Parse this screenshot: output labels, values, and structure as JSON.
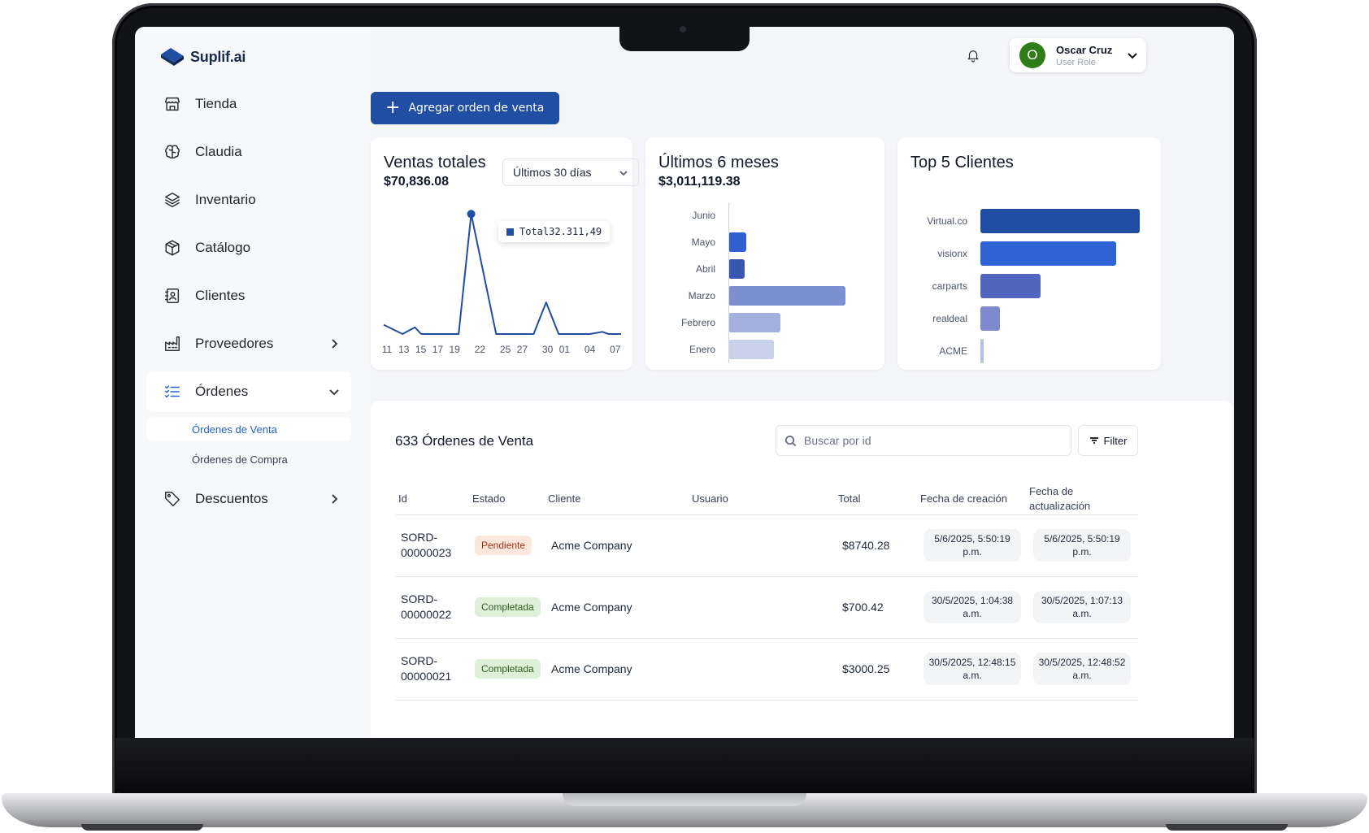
{
  "brand": {
    "name": "Suplif.ai"
  },
  "sidebar": {
    "items": [
      {
        "label": "Tienda",
        "icon": "store-icon"
      },
      {
        "label": "Claudia",
        "icon": "brain-icon"
      },
      {
        "label": "Inventario",
        "icon": "layers-icon"
      },
      {
        "label": "Catálogo",
        "icon": "package-icon"
      },
      {
        "label": "Clientes",
        "icon": "contact-book-icon"
      },
      {
        "label": "Proveedores",
        "icon": "factory-icon"
      },
      {
        "label": "Órdenes",
        "icon": "list-checks-icon"
      },
      {
        "label": "Descuentos",
        "icon": "tag-icon"
      }
    ],
    "sub_items": [
      {
        "label": "Órdenes de Venta",
        "active": true
      },
      {
        "label": "Órdenes de Compra",
        "active": false
      }
    ]
  },
  "header": {
    "user_name": "Oscar Cruz",
    "user_role": "User Role",
    "avatar_initial": "O",
    "avatar_color": "#2e7d18"
  },
  "actions": {
    "add_order_label": "Agregar orden de venta",
    "accent": "#1f4ea3"
  },
  "cards": {
    "sales": {
      "title": "Ventas totales",
      "value": "$70,836.08",
      "range_select": "Últimos 30 días",
      "tooltip_label": "Total",
      "tooltip_value": "32.311,49"
    },
    "months": {
      "title": "Últimos 6 meses",
      "value": "$3,011,119.38"
    },
    "clients": {
      "title": "Top 5 Clientes"
    }
  },
  "chart_data": [
    {
      "type": "line",
      "x_ticks": [
        "11",
        "13",
        "15",
        "17",
        "19",
        "22",
        "25",
        "27",
        "30",
        "01",
        "04",
        "07"
      ],
      "x": [
        0,
        3,
        5,
        6,
        10,
        12,
        14,
        18,
        20,
        22,
        24,
        26,
        28,
        33,
        35,
        36,
        38
      ],
      "values": [
        2500,
        0,
        1800,
        0,
        0,
        0,
        32311.49,
        0,
        0,
        0,
        0,
        8500,
        0,
        0,
        600,
        0,
        0
      ],
      "series": [
        {
          "name": "Total",
          "color": "#1f4ea3"
        }
      ],
      "ylim": [
        0,
        35000
      ],
      "grid": false
    },
    {
      "type": "bar",
      "orientation": "horizontal",
      "categories": [
        "Junio",
        "Mayo",
        "Abril",
        "Marzo",
        "Febrero",
        "Enero"
      ],
      "values": [
        0,
        160000,
        140000,
        1030000,
        460000,
        400000
      ],
      "colors": [
        "#2f5fd0",
        "#2f5fd0",
        "#3a56b3",
        "#7c8fd0",
        "#a3b0dd",
        "#c8d0ea"
      ],
      "xlim": [
        0,
        1100000
      ]
    },
    {
      "type": "bar",
      "orientation": "horizontal",
      "categories": [
        "Virtual.co",
        "visionx",
        "carparts",
        "realdeal",
        "ACME"
      ],
      "values": [
        100,
        85,
        38,
        12,
        2
      ],
      "colors": [
        "#1f4ea3",
        "#2f63d4",
        "#5266c0",
        "#7d89cc",
        "#b7bee3"
      ],
      "xlim": [
        0,
        100
      ]
    }
  ],
  "table": {
    "title": "633 Órdenes de Venta",
    "search_placeholder": "Buscar por id",
    "filter_label": "Filter",
    "headers": {
      "id": "Id",
      "status": "Estado",
      "client": "Cliente",
      "user": "Usuario",
      "total": "Total",
      "created": "Fecha de creación",
      "updated": "Fecha de actualización"
    },
    "rows": [
      {
        "id": "SORD-00000023",
        "status": "Pendiente",
        "client": "Acme Company",
        "user": "",
        "total": "$8740.28",
        "created": "5/6/2025, 5:50:19 p.m.",
        "updated": "5/6/2025, 5:50:19 p.m."
      },
      {
        "id": "SORD-00000022",
        "status": "Completada",
        "client": "Acme Company",
        "user": "",
        "total": "$700.42",
        "created": "30/5/2025, 1:04:38 a.m.",
        "updated": "30/5/2025, 1:07:13 a.m."
      },
      {
        "id": "SORD-00000021",
        "status": "Completada",
        "client": "Acme Company",
        "user": "",
        "total": "$3000.25",
        "created": "30/5/2025, 12:48:15 a.m.",
        "updated": "30/5/2025, 12:48:52 a.m."
      }
    ]
  }
}
